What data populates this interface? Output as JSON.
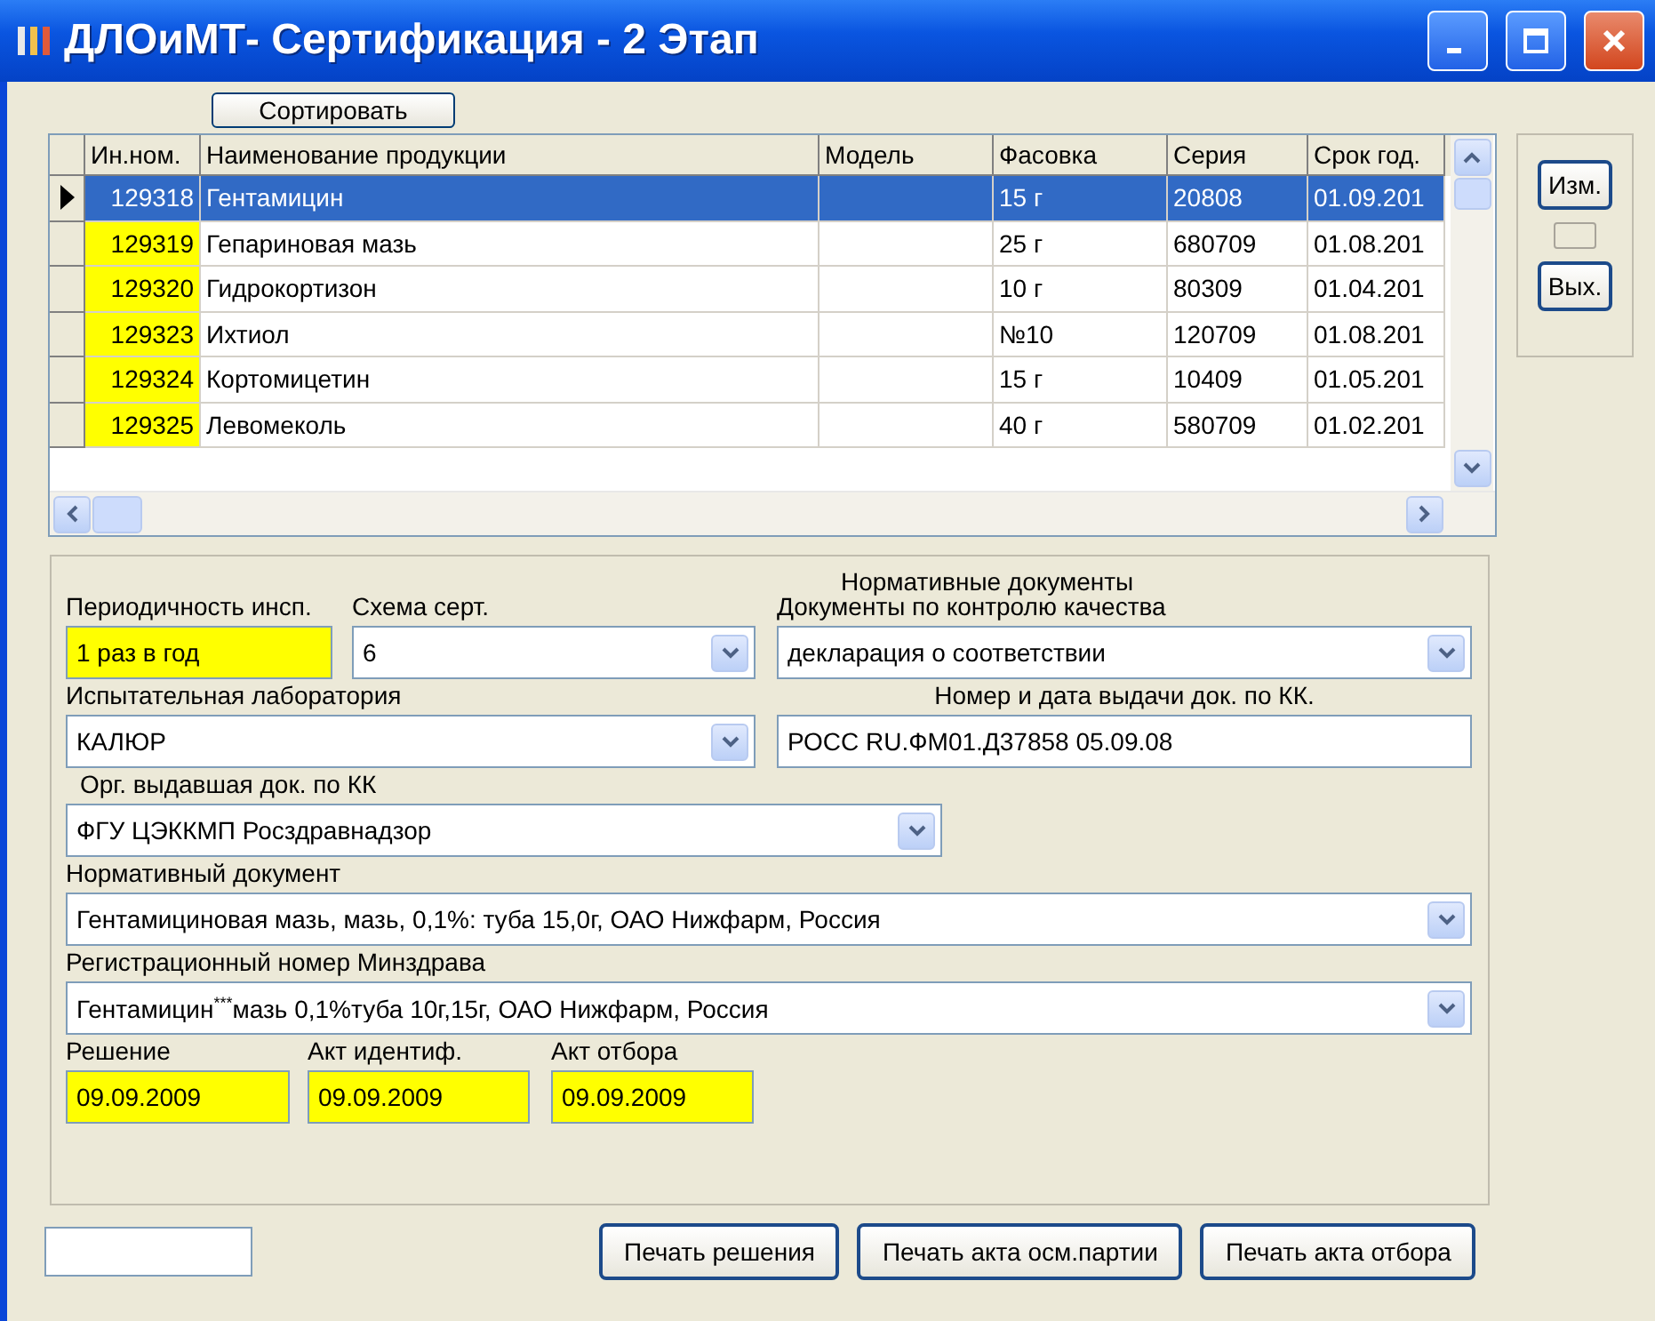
{
  "window": {
    "title": "ДЛОиМТ- Сертификация - 2 Этап"
  },
  "sort_button": "Сортировать",
  "table": {
    "columns": [
      "Ин.ном.",
      "Наименование продукции",
      "Модель",
      "Фасовка",
      "Серия",
      "Срок год."
    ],
    "rows": [
      {
        "selected": true,
        "cells": [
          "129318",
          "Гентамицин",
          "",
          "15 г",
          "20808",
          "01.09.201"
        ]
      },
      {
        "selected": false,
        "cells": [
          "129319",
          "Гепариновая мазь",
          "",
          "25 г",
          "680709",
          "01.08.201"
        ]
      },
      {
        "selected": false,
        "cells": [
          "129320",
          "Гидрокортизон",
          "",
          "10 г",
          "80309",
          "01.04.201"
        ]
      },
      {
        "selected": false,
        "cells": [
          "129323",
          "Ихтиол",
          "",
          "№10",
          "120709",
          "01.08.201"
        ]
      },
      {
        "selected": false,
        "cells": [
          "129324",
          "Кортомицетин",
          "",
          "15 г",
          "10409",
          "01.05.201"
        ]
      },
      {
        "selected": false,
        "cells": [
          "129325",
          "Левомеколь",
          "",
          "40 г",
          "580709",
          "01.02.201"
        ]
      }
    ]
  },
  "side_buttons": [
    {
      "kind": "text",
      "label": "Изм."
    },
    {
      "kind": "blank"
    },
    {
      "kind": "text",
      "label": "Вых."
    }
  ],
  "form": {
    "rows": [
      [
        {
          "kind": "text",
          "label": "Периодичность инсп.",
          "value": "1 раз в год",
          "highlighted": true
        },
        {
          "kind": "combo",
          "label": "Схема серт.",
          "value": "6",
          "highlighted": false
        },
        {
          "kind": "combo",
          "caption": "Нормативные документы",
          "label": "Документы по контролю качества",
          "value": "декларация о соответствии",
          "highlighted": false
        }
      ],
      [
        {
          "kind": "combo",
          "label": "Испытательная лаборатория",
          "value": "КАЛЮР",
          "highlighted": false
        },
        {
          "kind": "text",
          "label": "Номер и дата выдачи док. по КК.",
          "value": "РОСС RU.ФМ01.Д37858 05.09.08",
          "highlighted": false
        }
      ],
      [
        {
          "kind": "combo",
          "label": "Орг. выдавшая док. по КК",
          "value": "ФГУ ЦЭККМП Росздравнадзор",
          "highlighted": false
        }
      ],
      [
        {
          "kind": "combo",
          "label": "Нормативный документ",
          "value": "Гентамициновая мазь, мазь, 0,1%: туба 15,0г, ОАО Нижфарм, Россия",
          "highlighted": false
        }
      ],
      [
        {
          "kind": "combo",
          "label": "Регистрационный номер Минздрава",
          "value": "Гентамицин$^{***}$мазь 0,1%туба 10г,15г, ОАО Нижфарм, Россия",
          "highlighted": false
        }
      ],
      [
        {
          "kind": "text",
          "label": "Решение",
          "value": "09.09.2009",
          "highlighted": true
        },
        {
          "kind": "text",
          "label": "Акт идентиф.",
          "value": "09.09.2009",
          "highlighted": true
        },
        {
          "kind": "text",
          "label": "Акт отбора",
          "value": "09.09.2009",
          "highlighted": true
        }
      ]
    ]
  },
  "bottom_buttons": [
    "Печать решения",
    "Печать акта осм.партии",
    "Печать акта отбора"
  ]
}
